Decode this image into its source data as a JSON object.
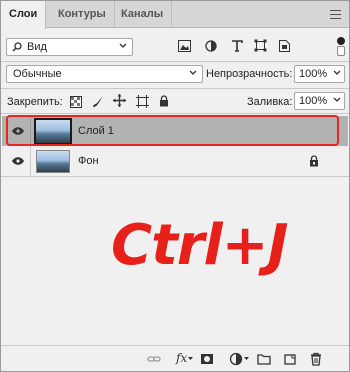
{
  "tabs": [
    {
      "label": "Слои"
    },
    {
      "label": "Контуры"
    },
    {
      "label": "Каналы"
    }
  ],
  "filter": {
    "kind_label": "Вид"
  },
  "blend": {
    "mode": "Обычные",
    "opacity_label": "Непрозрачность:",
    "opacity_value": "100%"
  },
  "lock": {
    "label": "Закрепить:",
    "fill_label": "Заливка:",
    "fill_value": "100%"
  },
  "layers": [
    {
      "name": "Слой 1",
      "selected": true,
      "visible": true,
      "locked": false
    },
    {
      "name": "Фон",
      "selected": false,
      "visible": true,
      "locked": true
    }
  ],
  "overlay_text": "Ctrl+J",
  "colors": {
    "accent_red": "#e8201a",
    "selected_row": "#b2b2b2"
  },
  "icons": {
    "filter_row": [
      "image-filter-icon",
      "adjustment-filter-icon",
      "type-filter-icon",
      "shape-filter-icon",
      "smart-object-filter-icon"
    ],
    "lock_row": [
      "lock-transparent-icon",
      "lock-image-icon",
      "lock-position-icon",
      "lock-artboard-icon",
      "lock-all-icon"
    ],
    "bottom": [
      "link-icon",
      "fx-icon",
      "mask-icon",
      "adjustment-layer-icon",
      "group-folder-icon",
      "new-layer-icon",
      "trash-icon"
    ]
  }
}
